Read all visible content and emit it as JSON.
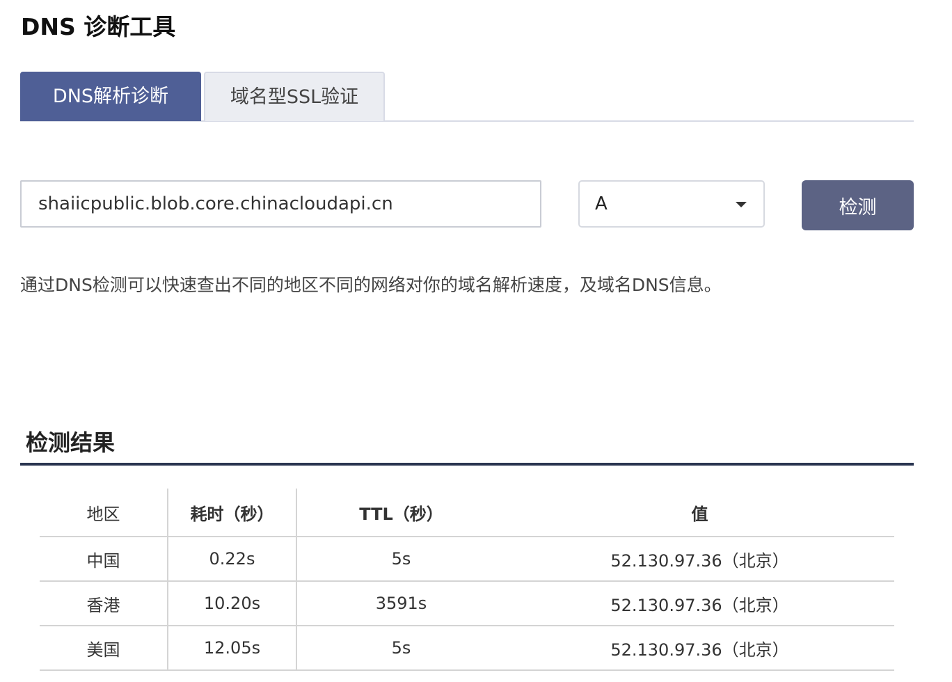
{
  "page": {
    "title": "DNS 诊断工具"
  },
  "tabs": [
    {
      "label": "DNS解析诊断",
      "active": true
    },
    {
      "label": "域名型SSL验证",
      "active": false
    }
  ],
  "form": {
    "domain_value": "shaiicpublic.blob.core.chinacloudapi.cn",
    "record_type": "A",
    "check_label": "检测"
  },
  "description": "通过DNS检测可以快速查出不同的地区不同的网络对你的域名解析速度，及域名DNS信息。",
  "results": {
    "title": "检测结果",
    "columns": [
      "地区",
      "耗时（秒）",
      "TTL（秒）",
      "值"
    ],
    "rows": [
      {
        "region": "中国",
        "time": "0.22s",
        "ttl": "5s",
        "value": "52.130.97.36（北京）"
      },
      {
        "region": "香港",
        "time": "10.20s",
        "ttl": "3591s",
        "value": "52.130.97.36（北京）"
      },
      {
        "region": "美国",
        "time": "12.05s",
        "ttl": "5s",
        "value": "52.130.97.36（北京）"
      }
    ]
  },
  "colors": {
    "tab_active_bg": "#4f5f96",
    "button_bg": "#5c6384",
    "divider": "#2a3550"
  }
}
